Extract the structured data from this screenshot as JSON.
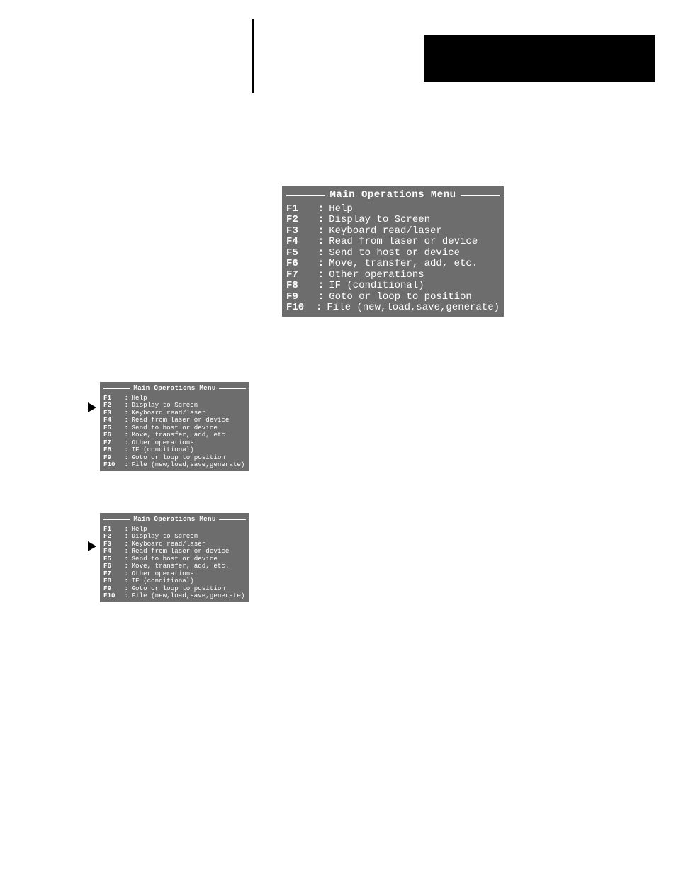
{
  "menu_title": "Main Operations Menu",
  "items": [
    {
      "key": "F1",
      "sep": ":",
      "label": "Help"
    },
    {
      "key": "F2",
      "sep": ":",
      "label": "Display to Screen"
    },
    {
      "key": "F3",
      "sep": ":",
      "label": "Keyboard read/laser"
    },
    {
      "key": "F4",
      "sep": ":",
      "label": "Read from laser or device"
    },
    {
      "key": "F5",
      "sep": ":",
      "label": "Send to host or device"
    },
    {
      "key": "F6",
      "sep": ":",
      "label": "Move, transfer, add, etc."
    },
    {
      "key": "F7",
      "sep": ":",
      "label": "Other operations"
    },
    {
      "key": "F8",
      "sep": ":",
      "label": "IF (conditional)"
    },
    {
      "key": "F9",
      "sep": ":",
      "label": "Goto or loop to position"
    },
    {
      "key": "F10",
      "sep": ":",
      "label": "File (new,load,save,generate)"
    }
  ]
}
